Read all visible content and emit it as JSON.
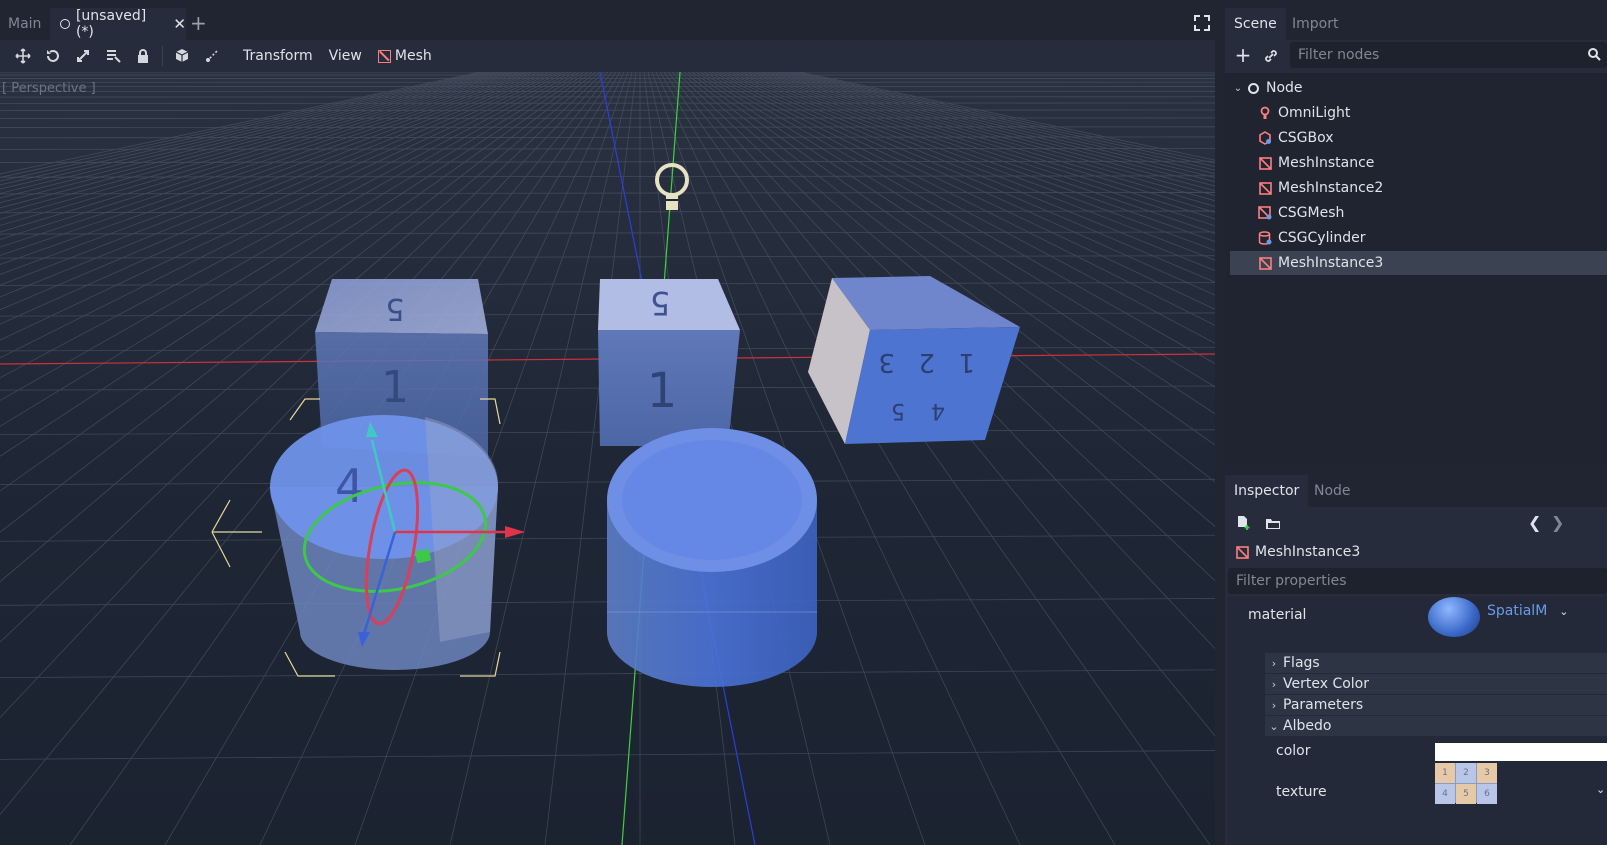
{
  "tabs": [
    {
      "label": "Main",
      "active": false
    },
    {
      "label": "[unsaved](*)",
      "active": true
    }
  ],
  "toolbar": {
    "menus": [
      "Transform",
      "View",
      "Mesh"
    ]
  },
  "viewport": {
    "label": "[ Perspective ]"
  },
  "scene_dock": {
    "tabs": [
      "Scene",
      "Import"
    ],
    "filter_placeholder": "Filter nodes",
    "nodes": [
      {
        "label": "Node",
        "icon": "node-icon",
        "root": true
      },
      {
        "label": "OmniLight",
        "icon": "omnilight-icon"
      },
      {
        "label": "CSGBox",
        "icon": "csgbox-icon"
      },
      {
        "label": "MeshInstance",
        "icon": "meshinstance-icon"
      },
      {
        "label": "MeshInstance2",
        "icon": "meshinstance-icon"
      },
      {
        "label": "CSGMesh",
        "icon": "csgmesh-icon"
      },
      {
        "label": "CSGCylinder",
        "icon": "csgcylinder-icon"
      },
      {
        "label": "MeshInstance3",
        "icon": "meshinstance-icon",
        "selected": true
      }
    ]
  },
  "inspector": {
    "tabs": [
      "Inspector",
      "Node"
    ],
    "object_name": "MeshInstance3",
    "filter_placeholder": "Filter properties",
    "material_label": "material",
    "material_value": "SpatialM",
    "sections": [
      {
        "label": "Flags",
        "expanded": false
      },
      {
        "label": "Vertex Color",
        "expanded": false
      },
      {
        "label": "Parameters",
        "expanded": false
      },
      {
        "label": "Albedo",
        "expanded": true
      }
    ],
    "albedo": {
      "color_label": "color",
      "color_value": "#ffffff",
      "texture_label": "texture",
      "texture_digits": [
        "1",
        "2",
        "3",
        "4",
        "5",
        "6"
      ]
    }
  },
  "colors": {
    "accent": "#699ce8",
    "mesh_icon": "#fc7f7f",
    "bg_dark": "#202531",
    "bg_panel": "#262c3b"
  }
}
